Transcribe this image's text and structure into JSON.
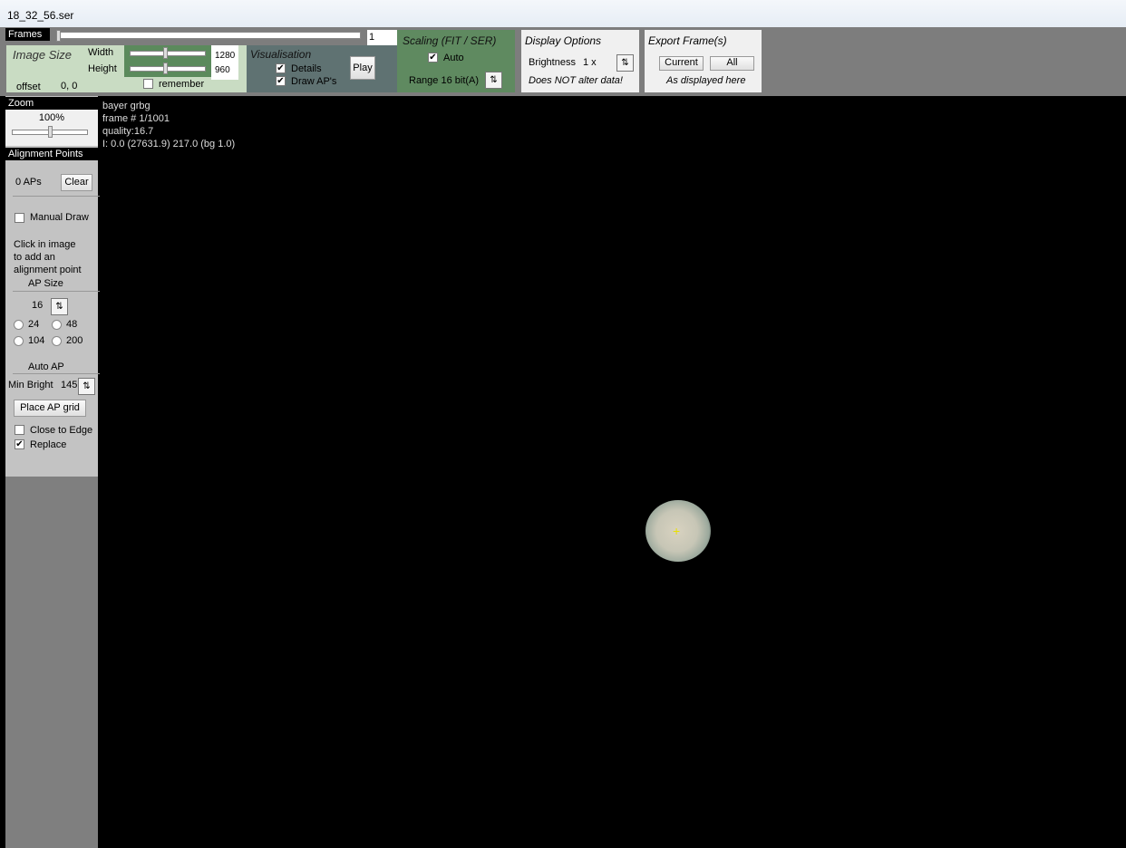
{
  "window": {
    "title": "18_32_56.ser"
  },
  "frames": {
    "label": "Frames",
    "value": "1",
    "position": 0.0
  },
  "image_size": {
    "title": "Image Size",
    "width_label": "Width",
    "height_label": "Height",
    "width": "1280",
    "height": "960",
    "offset_label": "offset",
    "offset": "0, 0",
    "remember_label": "remember",
    "remember": false
  },
  "visualisation": {
    "title": "Visualisation",
    "details_label": "Details",
    "details": true,
    "draw_aps_label": "Draw AP's",
    "draw_aps": true,
    "play_label": "Play"
  },
  "scaling": {
    "title": "Scaling (FIT / SER)",
    "auto_label": "Auto",
    "auto": true,
    "range_label": "Range 16 bit(A)"
  },
  "display": {
    "title": "Display Options",
    "brightness_label": "Brightness",
    "brightness": "1 x",
    "note": "Does NOT alter data!"
  },
  "export": {
    "title": "Export Frame(s)",
    "current_label": "Current",
    "all_label": "All",
    "note": "As displayed here"
  },
  "zoom": {
    "label": "Zoom",
    "value": "100%"
  },
  "ap": {
    "header": "Alignment Points",
    "count": "0 APs",
    "clear_label": "Clear",
    "manual_draw_label": "Manual Draw",
    "manual_draw": false,
    "hint": [
      "Click in image",
      "to add an",
      "alignment point"
    ],
    "size_label": "AP Size",
    "size": "16",
    "size_options": [
      "24",
      "48",
      "104",
      "200"
    ],
    "auto_label": "Auto AP",
    "min_bright_label": "Min Bright",
    "min_bright": "145",
    "place_grid_label": "Place AP grid",
    "close_edge_label": "Close to Edge",
    "close_edge": false,
    "replace_label": "Replace",
    "replace": true
  },
  "info": {
    "bayer": "bayer grbg",
    "frame": "frame # 1/1001",
    "quality": "quality:16.7",
    "intensity": "I: 0.0 (27631.9) 217.0 (bg 1.0)"
  },
  "colors": {
    "image_size_bg": "#c9dcc3",
    "slider_bg": "#5b8a5c",
    "visual_bg": "#5f7272",
    "scaling_bg": "#5f8a60",
    "panel_bg": "#f0f0f0",
    "ap_marker": "#e8e000"
  }
}
